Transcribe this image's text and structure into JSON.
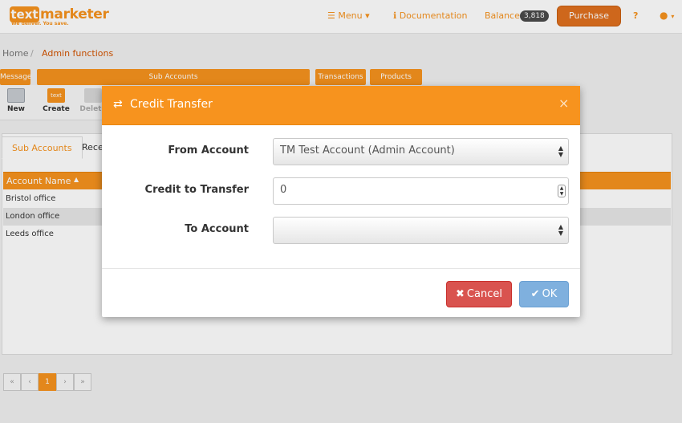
{
  "navbar": {
    "logo_box": "text",
    "logo_word": "marketer",
    "logo_tagline": "We deliver. You save.",
    "menu_label": "Menu",
    "documentation_label": "Documentation",
    "balance_label": "Balance",
    "balance_value": "3,818",
    "purchase_label": "Purchase",
    "help_label": "?"
  },
  "breadcrumb": {
    "home": "Home",
    "separator": "/",
    "current": "Admin functions"
  },
  "ribbon": {
    "groups": [
      "Message",
      "Sub Accounts",
      "Transactions",
      "Products"
    ],
    "buttons": {
      "new": "New",
      "create": "Create",
      "delete": "Delete",
      "create_icon_text": "text"
    }
  },
  "tabs": [
    "Sub Accounts",
    "Received"
  ],
  "grid": {
    "column": "Account Name",
    "rows": [
      "Bristol office",
      "London office",
      "Leeds office"
    ]
  },
  "pager": {
    "first": "«",
    "prev": "‹",
    "current": "1",
    "next": "›",
    "last": "»"
  },
  "modal": {
    "title": "Credit Transfer",
    "transfer_glyph": "⇄",
    "close_glyph": "×",
    "from_label": "From Account",
    "from_value": "TM Test Account (Admin Account)",
    "credit_label": "Credit to Transfer",
    "credit_value": "0",
    "to_label": "To Account",
    "to_value": "",
    "cancel_label": "Cancel",
    "ok_label": "OK"
  },
  "colors": {
    "accent": "#f7931e",
    "danger": "#d9534f",
    "primary_disabled": "#7fb0de"
  },
  "icons": [
    "menu-icon",
    "info-icon",
    "user-icon",
    "transfer-icon",
    "close-icon",
    "check-icon",
    "times-icon"
  ]
}
